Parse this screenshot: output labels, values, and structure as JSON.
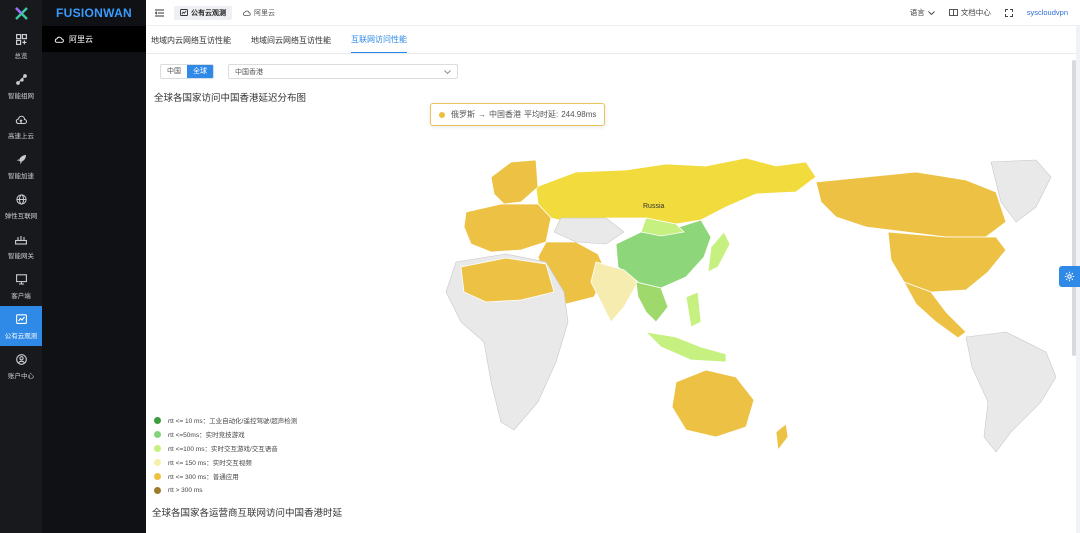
{
  "rail": [
    {
      "label": "总览",
      "icon": "grid-icon"
    },
    {
      "label": "智能组网",
      "icon": "network-icon"
    },
    {
      "label": "高速上云",
      "icon": "cloud-up-icon"
    },
    {
      "label": "智能加速",
      "icon": "rocket-icon"
    },
    {
      "label": "弹性互联网",
      "icon": "globe-icon"
    },
    {
      "label": "智能网关",
      "icon": "router-icon"
    },
    {
      "label": "客户端",
      "icon": "monitor-icon"
    },
    {
      "label": "公有云观测",
      "icon": "dashboard-icon",
      "active": true
    },
    {
      "label": "账户中心",
      "icon": "user-icon"
    }
  ],
  "brand": "FUSIONWAN",
  "side": {
    "item": "阿里云"
  },
  "topbar": {
    "tabs": [
      {
        "label": "公有云观测",
        "active": true
      },
      {
        "label": "阿里云",
        "active": false
      }
    ],
    "language": "语言",
    "docs": "文档中心",
    "user": "syscloudvpn"
  },
  "main": {
    "tabs": [
      {
        "label": "地域内云网络互访性能",
        "active": false
      },
      {
        "label": "地域间云网络互访性能",
        "active": false
      },
      {
        "label": "互联网访问性能",
        "active": true
      }
    ],
    "scope": {
      "options": [
        "中国",
        "全球"
      ],
      "selected": "全球"
    },
    "region_select": "中国香港",
    "map_title": "全球各国家访问中国香港延迟分布图",
    "tooltip": {
      "country": "俄罗斯",
      "arrow": "→",
      "target": "中国香港",
      "label": "平均时延:",
      "value": "244.98ms"
    },
    "map_label": "Russia",
    "legend": [
      {
        "label": "rtt <= 10 ms：工业自动化/遥控驾驶/超声检测",
        "color": "#3a9e3d"
      },
      {
        "label": "rtt <=50ms：实时竞技游戏",
        "color": "#86d27a"
      },
      {
        "label": "rtt <=100 ms：实时交互游戏/交互语音",
        "color": "#c6f07f"
      },
      {
        "label": "rtt <= 150 ms：实时交互视频",
        "color": "#f6f0a8"
      },
      {
        "label": "rtt <= 300 ms：普通应用",
        "color": "#edc244"
      },
      {
        "label": "rtt > 300 ms",
        "color": "#9b7d2c"
      }
    ],
    "bottom_title": "全球各国家各运营商互联网访问中国香港时延"
  }
}
